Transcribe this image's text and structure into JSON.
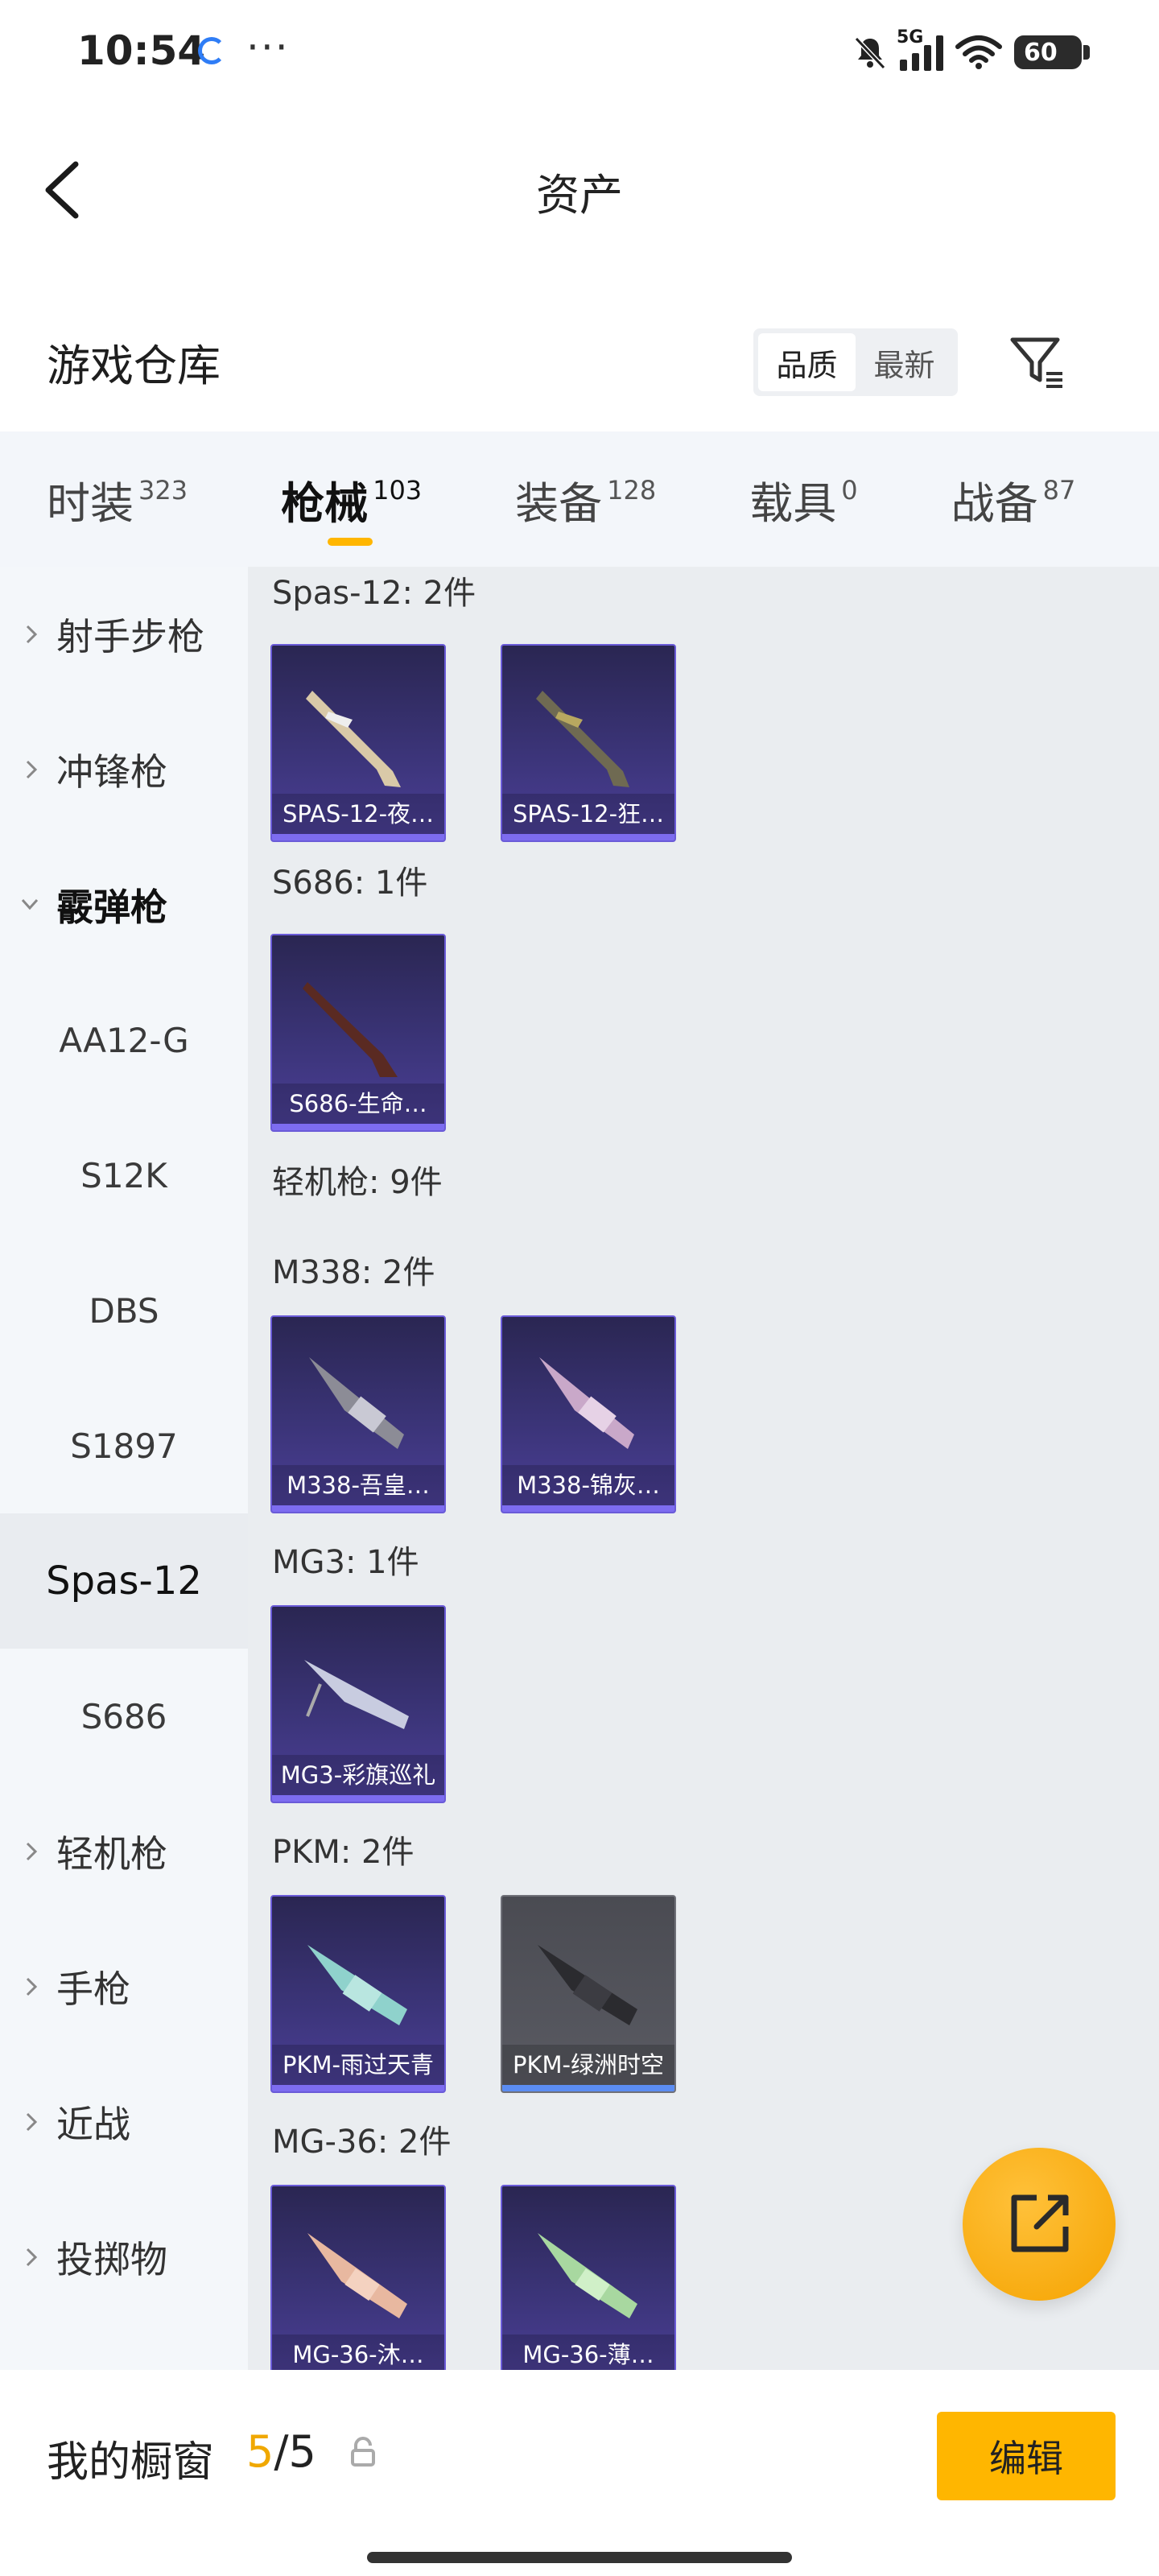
{
  "status_bar": {
    "time": "10:54",
    "network": "5G",
    "battery": "60"
  },
  "header": {
    "title": "资产"
  },
  "warehouse": {
    "title": "游戏仓库",
    "sort_options": [
      "品质",
      "最新"
    ],
    "active_sort": "品质"
  },
  "tabs": [
    {
      "label": "时装",
      "count": "323"
    },
    {
      "label": "枪械",
      "count": "103",
      "active": true
    },
    {
      "label": "装备",
      "count": "128"
    },
    {
      "label": "载具",
      "count": "0"
    },
    {
      "label": "战备",
      "count": "87"
    }
  ],
  "sidebar": {
    "items": [
      {
        "label": "射手步枪"
      },
      {
        "label": "冲锋枪"
      },
      {
        "label": "霰弹枪"
      },
      {
        "label": "AA12-G"
      },
      {
        "label": "S12K"
      },
      {
        "label": "DBS"
      },
      {
        "label": "S1897"
      },
      {
        "label": "Spas-12"
      },
      {
        "label": "S686"
      },
      {
        "label": "轻机枪"
      },
      {
        "label": "手枪"
      },
      {
        "label": "近战"
      },
      {
        "label": "投掷物"
      }
    ]
  },
  "content": {
    "groups": [
      {
        "label": "Spas-12: 2件",
        "items": [
          "SPAS-12-夜…",
          "SPAS-12-狂…"
        ]
      },
      {
        "label": "S686: 1件",
        "items": [
          "S686-生命…"
        ]
      },
      {
        "label": "轻机枪: 9件"
      },
      {
        "label": "M338: 2件",
        "items": [
          "M338-吾皇…",
          "M338-锦灰…"
        ]
      },
      {
        "label": "MG3: 1件",
        "items": [
          "MG3-彩旗巡礼"
        ]
      },
      {
        "label": "PKM: 2件",
        "items": [
          "PKM-雨过天青",
          "PKM-绿洲时空"
        ]
      },
      {
        "label": "MG-36: 2件",
        "items": [
          "MG-36-沐…",
          "MG-36-薄…"
        ]
      }
    ]
  },
  "bottom": {
    "title": "我的橱窗",
    "current": "5",
    "total": "/5",
    "edit_label": "编辑"
  },
  "colors": {
    "accent": "#ffb600",
    "card_purple": "#3b3478",
    "card_gray": "#5a5b63"
  }
}
